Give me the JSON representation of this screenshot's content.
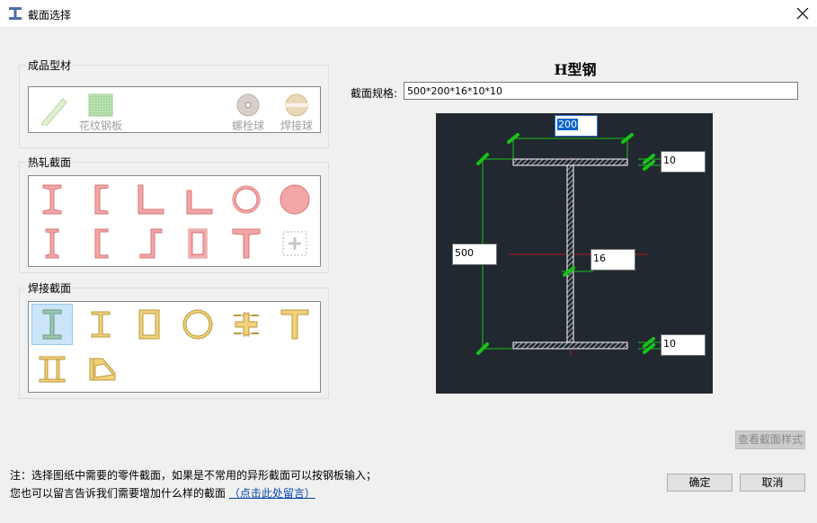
{
  "window": {
    "title": "截面选择"
  },
  "groups": {
    "products": {
      "label": "成品型材",
      "items": [
        {
          "name": "flat-bar",
          "caption": ""
        },
        {
          "name": "checkered-plate",
          "caption": "花纹钢板"
        },
        {
          "name": "bolt-ball",
          "caption": "螺栓球"
        },
        {
          "name": "weld-ball",
          "caption": "焊接球"
        }
      ]
    },
    "hot_rolled": {
      "label": "热轧截面",
      "items": [
        "i-beam",
        "channel",
        "angle-equal",
        "angle-unequal",
        "round-tube",
        "round-bar",
        "narrow-i-beam",
        "box-channel",
        "z-section",
        "rect-tube",
        "tee-section",
        "add-section"
      ]
    },
    "welded": {
      "label": "焊接截面",
      "items": [
        "h-beam",
        "narrow-h-beam",
        "box-section",
        "welded-round-tube",
        "cross-section",
        "welded-tee",
        "double-i-section",
        "tapered-section"
      ]
    }
  },
  "detail": {
    "title": "H型钢",
    "spec_label": "截面规格:",
    "spec_value": "500*200*16*10*10",
    "dimensions": {
      "width": "200",
      "height": "500",
      "web": "16",
      "flange_top": "10",
      "flange_bottom": "10"
    }
  },
  "buttons": {
    "view_style": "查看截面样式",
    "ok": "确定",
    "cancel": "取消"
  },
  "notes": {
    "line1": "注：选择图纸中需要的零件截面，如果是不常用的异形截面可以按钢板输入；",
    "line2": "您也可以留言告诉我们需要增加什么样的截面",
    "link": "（点击此处留言）"
  },
  "colors": {
    "hot_rolled": "#f4a5a5",
    "welded": "#f2d17a",
    "selected_bg": "#cce4f7",
    "drawing_bg": "#212830",
    "dim_green": "#19c219"
  }
}
